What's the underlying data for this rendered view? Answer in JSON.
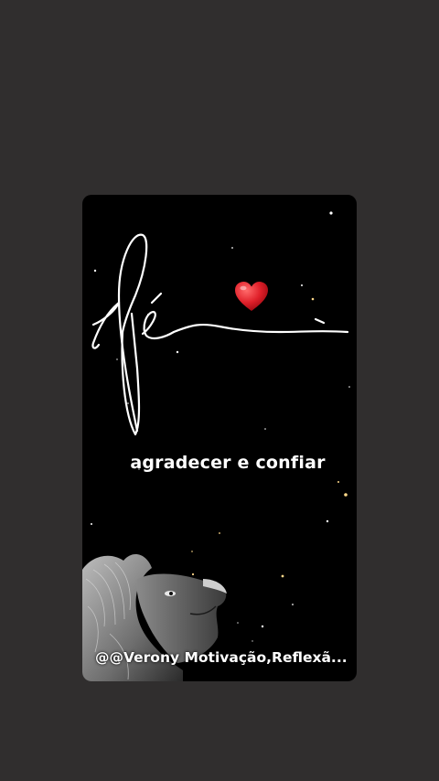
{
  "screen": {
    "background_color": "#302e2e"
  },
  "story": {
    "background_color": "#000000",
    "script_word": "fé",
    "heart": {
      "icon": "red-heart-icon",
      "color": "#e0202a"
    },
    "caption": "agradecer e confiar",
    "author_tag": "@@Verony Motivação,Reflexã...",
    "image": {
      "icon": "lion-looking-up-image"
    }
  }
}
